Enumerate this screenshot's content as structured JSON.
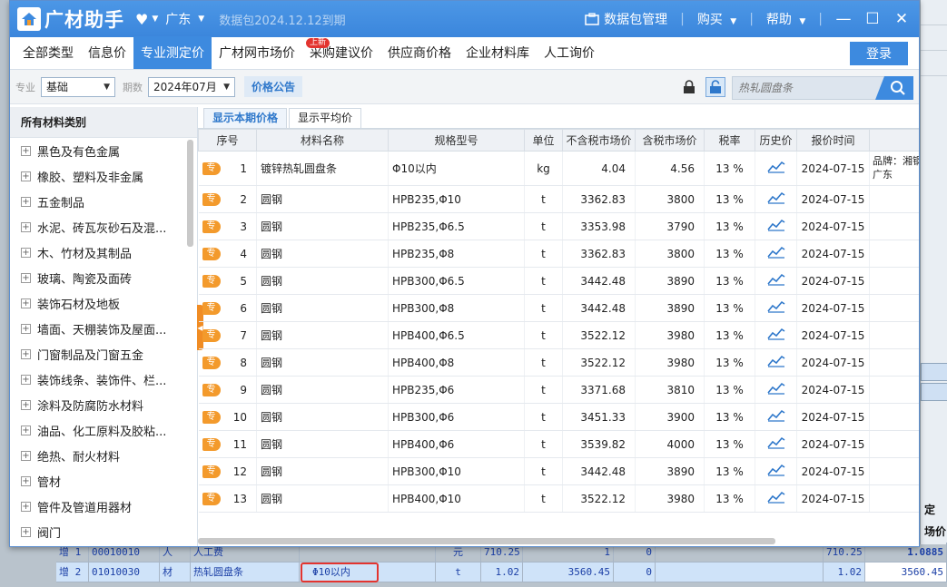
{
  "app": {
    "name": "广材助手",
    "region": "广东",
    "package_expiry": "数据包2024.12.12到期",
    "package_mgmt": "数据包管理",
    "buy": "购买",
    "help": "帮助"
  },
  "nav": {
    "tabs": [
      "全部类型",
      "信息价",
      "专业测定价",
      "广材网市场价",
      "采购建议价",
      "供应商价格",
      "企业材料库",
      "人工询价"
    ],
    "active_index": 2,
    "new_badge": "上新",
    "login": "登录"
  },
  "filters": {
    "major_label": "专业",
    "major_value": "基础",
    "period_label": "期数",
    "period_value": "2024年07月",
    "price_notice": "价格公告",
    "search_placeholder": "热轧圆盘条"
  },
  "sidebar": {
    "title": "所有材料类别",
    "categories": [
      "黑色及有色金属",
      "橡胶、塑料及非金属",
      "五金制品",
      "水泥、砖瓦灰砂石及混...",
      "木、竹材及其制品",
      "玻璃、陶瓷及面砖",
      "装饰石材及地板",
      "墙面、天棚装饰及屋面...",
      "门窗制品及门窗五金",
      "装饰线条、装饰件、栏...",
      "涂料及防腐防水材料",
      "油品、化工原料及胶粘...",
      "绝热、耐火材料",
      "管材",
      "管件及管道用器材",
      "阀门"
    ]
  },
  "subtabs": [
    "显示本期价格",
    "显示平均价"
  ],
  "table": {
    "headers": [
      "序号",
      "材料名称",
      "规格型号",
      "单位",
      "不含税市场价",
      "含税市场价",
      "税率",
      "历史价",
      "报价时间"
    ],
    "badge": "专",
    "extra_note": "品牌：湘钢 区：广东",
    "rows": [
      {
        "no": "1",
        "name": "镀锌热轧圆盘条",
        "spec": "Φ10以内",
        "unit": "kg",
        "excl": "4.04",
        "incl": "4.56",
        "tax": "13 %",
        "date": "2024-07-15"
      },
      {
        "no": "2",
        "name": "圆钢",
        "spec": "HPB235,Φ10",
        "unit": "t",
        "excl": "3362.83",
        "incl": "3800",
        "tax": "13 %",
        "date": "2024-07-15"
      },
      {
        "no": "3",
        "name": "圆钢",
        "spec": "HPB235,Φ6.5",
        "unit": "t",
        "excl": "3353.98",
        "incl": "3790",
        "tax": "13 %",
        "date": "2024-07-15"
      },
      {
        "no": "4",
        "name": "圆钢",
        "spec": "HPB235,Φ8",
        "unit": "t",
        "excl": "3362.83",
        "incl": "3800",
        "tax": "13 %",
        "date": "2024-07-15"
      },
      {
        "no": "5",
        "name": "圆钢",
        "spec": "HPB300,Φ6.5",
        "unit": "t",
        "excl": "3442.48",
        "incl": "3890",
        "tax": "13 %",
        "date": "2024-07-15"
      },
      {
        "no": "6",
        "name": "圆钢",
        "spec": "HPB300,Φ8",
        "unit": "t",
        "excl": "3442.48",
        "incl": "3890",
        "tax": "13 %",
        "date": "2024-07-15"
      },
      {
        "no": "7",
        "name": "圆钢",
        "spec": "HPB400,Φ6.5",
        "unit": "t",
        "excl": "3522.12",
        "incl": "3980",
        "tax": "13 %",
        "date": "2024-07-15"
      },
      {
        "no": "8",
        "name": "圆钢",
        "spec": "HPB400,Φ8",
        "unit": "t",
        "excl": "3522.12",
        "incl": "3980",
        "tax": "13 %",
        "date": "2024-07-15"
      },
      {
        "no": "9",
        "name": "圆钢",
        "spec": "HPB235,Φ6",
        "unit": "t",
        "excl": "3371.68",
        "incl": "3810",
        "tax": "13 %",
        "date": "2024-07-15"
      },
      {
        "no": "10",
        "name": "圆钢",
        "spec": "HPB300,Φ6",
        "unit": "t",
        "excl": "3451.33",
        "incl": "3900",
        "tax": "13 %",
        "date": "2024-07-15"
      },
      {
        "no": "11",
        "name": "圆钢",
        "spec": "HPB400,Φ6",
        "unit": "t",
        "excl": "3539.82",
        "incl": "4000",
        "tax": "13 %",
        "date": "2024-07-15"
      },
      {
        "no": "12",
        "name": "圆钢",
        "spec": "HPB300,Φ10",
        "unit": "t",
        "excl": "3442.48",
        "incl": "3890",
        "tax": "13 %",
        "date": "2024-07-15"
      },
      {
        "no": "13",
        "name": "圆钢",
        "spec": "HPB400,Φ10",
        "unit": "t",
        "excl": "3522.12",
        "incl": "3980",
        "tax": "13 %",
        "date": "2024-07-15"
      }
    ]
  },
  "background": {
    "right_labels": [
      "定",
      "场价"
    ],
    "rows": [
      {
        "tag": "增",
        "no": "1",
        "code": "00010010",
        "type": "人",
        "name": "人工费",
        "spec": "",
        "unit": "元",
        "qty": "710.25",
        "price": "1",
        "v0": "0",
        "total": "710.25",
        "last": "1.0885"
      },
      {
        "tag": "增",
        "no": "2",
        "code": "01010030",
        "type": "材",
        "name": "热轧圆盘条",
        "spec": "Φ10以内",
        "unit": "t",
        "qty": "1.02",
        "price": "3560.45",
        "v0": "0",
        "total": "1.02",
        "last": "3560.45"
      }
    ]
  },
  "colors": {
    "accent": "#3d8adf",
    "badge": "#f39a2c",
    "new": "#e3342f"
  }
}
